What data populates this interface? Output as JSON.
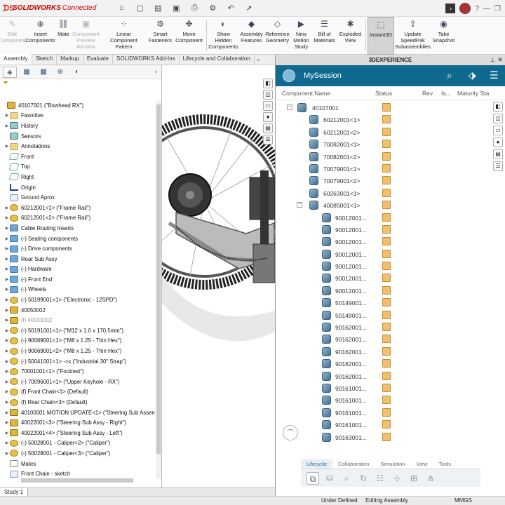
{
  "app": {
    "logo_brand": "SOLIDWORKS",
    "logo_suffix": "Connected",
    "accent": "#c00000"
  },
  "ribbon": {
    "buttons": [
      {
        "label": "Edit\nComponent",
        "icon": "edit-component-icon",
        "disabled": true
      },
      {
        "label": "Insert\nComponents",
        "icon": "insert-components-icon",
        "disabled": false
      },
      {
        "label": "Mate",
        "icon": "mate-icon",
        "disabled": false
      },
      {
        "label": "Component\nPreview\nWindow",
        "icon": "component-preview-icon",
        "disabled": true
      },
      {
        "label": "Linear Component\nPattern",
        "icon": "linear-pattern-icon",
        "disabled": false
      },
      {
        "label": "Smart\nFasteners",
        "icon": "smart-fasteners-icon",
        "disabled": false
      },
      {
        "label": "Move\nComponent",
        "icon": "move-component-icon",
        "disabled": false
      },
      {
        "label": "Show\nHidden\nComponents",
        "icon": "show-hidden-icon",
        "disabled": false
      },
      {
        "label": "Assembly\nFeatures",
        "icon": "assembly-features-icon",
        "disabled": false
      },
      {
        "label": "Reference\nGeometry",
        "icon": "reference-geometry-icon",
        "disabled": false
      },
      {
        "label": "New\nMotion\nStudy",
        "icon": "motion-study-icon",
        "disabled": false
      },
      {
        "label": "Bill of\nMaterials",
        "icon": "bom-icon",
        "disabled": false
      },
      {
        "label": "Exploded\nView",
        "icon": "exploded-view-icon",
        "disabled": false
      },
      {
        "label": "Instant3D",
        "icon": "instant3d-icon",
        "disabled": false,
        "active": true
      },
      {
        "label": "Update\nSpeedPak\nSubassemblies",
        "icon": "speedpak-icon",
        "disabled": false
      },
      {
        "label": "Take\nSnapshot",
        "icon": "snapshot-icon",
        "disabled": false
      }
    ]
  },
  "command_tabs": [
    "Assembly",
    "Sketch",
    "Markup",
    "Evaluate",
    "SOLIDWORKS Add-Ins",
    "Lifecycle and Collaboration"
  ],
  "feature_tree": [
    {
      "label": "40107001 (\"Bowhead RX\")",
      "icon": "asm",
      "level": 0,
      "exp": ""
    },
    {
      "label": "Favorites",
      "icon": "note",
      "level": 1,
      "exp": "▶"
    },
    {
      "label": "History",
      "icon": "sensor",
      "level": 1,
      "exp": "▶"
    },
    {
      "label": "Sensors",
      "icon": "sensor",
      "level": 1,
      "exp": ""
    },
    {
      "label": "Annotations",
      "icon": "note",
      "level": 1,
      "exp": "▶"
    },
    {
      "label": "Front",
      "icon": "plane",
      "level": 1,
      "exp": ""
    },
    {
      "label": "Top",
      "icon": "plane",
      "level": 1,
      "exp": ""
    },
    {
      "label": "Right",
      "icon": "plane",
      "level": 1,
      "exp": ""
    },
    {
      "label": "Origin",
      "icon": "origin",
      "level": 1,
      "exp": ""
    },
    {
      "label": "Ground Aprox",
      "icon": "sketch",
      "level": 1,
      "exp": ""
    },
    {
      "label": "60212001<1> (\"Frame Rail\")",
      "icon": "part",
      "level": 1,
      "exp": "▶"
    },
    {
      "label": "60212001<2> (\"Frame Rail\")",
      "icon": "part",
      "level": 1,
      "exp": "▶"
    },
    {
      "label": "Cable Routing Inserts",
      "icon": "folder",
      "level": 1,
      "exp": "▶"
    },
    {
      "label": "(-) Seating components",
      "icon": "folder",
      "level": 1,
      "exp": "▶"
    },
    {
      "label": "(-) Drive components",
      "icon": "folder",
      "level": 1,
      "exp": "▶"
    },
    {
      "label": "Rear Sub Assy",
      "icon": "folder",
      "level": 1,
      "exp": "▶"
    },
    {
      "label": "(-) Hardware",
      "icon": "folder",
      "level": 1,
      "exp": "▶"
    },
    {
      "label": "(-) Front End",
      "icon": "folder",
      "level": 1,
      "exp": "▶"
    },
    {
      "label": "(-) Wheels",
      "icon": "folder",
      "level": 1,
      "exp": "▶"
    },
    {
      "label": "(-) 50199001<1> (\"Electronic - 12SPD\")",
      "icon": "part",
      "level": 1,
      "exp": "▶"
    },
    {
      "label": "40050002",
      "icon": "asm",
      "level": 1,
      "exp": "▶"
    },
    {
      "label": "(f) 40033002",
      "icon": "asm",
      "level": 1,
      "exp": "▶",
      "dim": true
    },
    {
      "label": "(-) 50191001<1> (\"M12 x 1.0 x 170.5mm\")",
      "icon": "part",
      "level": 1,
      "exp": "▶"
    },
    {
      "label": "(-) 90069001<1> (\"M8 x 1.25 - Thin Hex\")",
      "icon": "part",
      "level": 1,
      "exp": "▶"
    },
    {
      "label": "(-) 90069001<2> (\"M8 x 1.25 - Thin Hex\")",
      "icon": "part",
      "level": 1,
      "exp": "▶"
    },
    {
      "label": "(-) 50041001<1> ->x (\"Industrial 30\" Strap\")",
      "icon": "part",
      "level": 1,
      "exp": "▶"
    },
    {
      "label": "70001001<1> (\"Footrest\")",
      "icon": "part",
      "level": 1,
      "exp": "▶"
    },
    {
      "label": "(-) 70096001<1> (\"Upper Keyhole - RX\")",
      "icon": "part",
      "level": 1,
      "exp": "▶"
    },
    {
      "label": "(f) Front Chain<1> (Default)",
      "icon": "part",
      "level": 1,
      "exp": "▶"
    },
    {
      "label": "(f) Rear Chain<3> (Default)",
      "icon": "part",
      "level": 1,
      "exp": "▶"
    },
    {
      "label": "40100001 MOTION UPDATE<1> (\"Steering Sub Assen",
      "icon": "asm",
      "level": 1,
      "exp": "▶"
    },
    {
      "label": "40022001<3> (\"Steering Sub Assy - Right\")",
      "icon": "asm",
      "level": 1,
      "exp": "▶"
    },
    {
      "label": "40022001<4> (\"Steering Sub Assy - Left\")",
      "icon": "asm",
      "level": 1,
      "exp": "▶"
    },
    {
      "label": "(-) 50028001 - Caliper<2> (\"Caliper\")",
      "icon": "part",
      "level": 1,
      "exp": "▶"
    },
    {
      "label": "(-) 50028001 - Caliper<3> (\"Caliper\")",
      "icon": "part",
      "level": 1,
      "exp": "▶"
    },
    {
      "label": "Mates",
      "icon": "mates",
      "level": 1,
      "exp": ""
    },
    {
      "label": "Front Chain - sketch",
      "icon": "sketch",
      "level": 1,
      "exp": ""
    }
  ],
  "bottom_tab": "Study 1",
  "status": {
    "left": "Under Defined",
    "mid": "Editing Assembly",
    "units": "MMGS"
  },
  "x3d": {
    "panel_title": "3DEXPERIENCE",
    "session_name": "MySession",
    "columns": {
      "name": "Component Name",
      "status": "Status",
      "rev": "Rev",
      "is": "Is...",
      "maturity": "Maturity Sta"
    },
    "rows": [
      {
        "label": "40107001",
        "level": 0,
        "exp": "−"
      },
      {
        "label": "60212001<1>",
        "level": 1,
        "exp": ""
      },
      {
        "label": "60212001<2>",
        "level": 1,
        "exp": ""
      },
      {
        "label": "70082001<1>",
        "level": 1,
        "exp": ""
      },
      {
        "label": "70082001<2>",
        "level": 1,
        "exp": ""
      },
      {
        "label": "70079001<1>",
        "level": 1,
        "exp": ""
      },
      {
        "label": "70079001<2>",
        "level": 1,
        "exp": ""
      },
      {
        "label": "60263001<1>",
        "level": 1,
        "exp": ""
      },
      {
        "label": "40085001<1>",
        "level": 1,
        "exp": "−"
      },
      {
        "label": "90012001...",
        "level": 2,
        "exp": ""
      },
      {
        "label": "90012001...",
        "level": 2,
        "exp": ""
      },
      {
        "label": "90012001...",
        "level": 2,
        "exp": ""
      },
      {
        "label": "90012001...",
        "level": 2,
        "exp": ""
      },
      {
        "label": "90012001...",
        "level": 2,
        "exp": ""
      },
      {
        "label": "90012001...",
        "level": 2,
        "exp": ""
      },
      {
        "label": "90012001...",
        "level": 2,
        "exp": ""
      },
      {
        "label": "50149001...",
        "level": 2,
        "exp": ""
      },
      {
        "label": "50149001...",
        "level": 2,
        "exp": ""
      },
      {
        "label": "90162001...",
        "level": 2,
        "exp": ""
      },
      {
        "label": "90162001...",
        "level": 2,
        "exp": ""
      },
      {
        "label": "90162001...",
        "level": 2,
        "exp": ""
      },
      {
        "label": "90162001...",
        "level": 2,
        "exp": ""
      },
      {
        "label": "90162001...",
        "level": 2,
        "exp": ""
      },
      {
        "label": "90161001...",
        "level": 2,
        "exp": ""
      },
      {
        "label": "90161001...",
        "level": 2,
        "exp": ""
      },
      {
        "label": "90161001...",
        "level": 2,
        "exp": ""
      },
      {
        "label": "90161001...",
        "level": 2,
        "exp": ""
      },
      {
        "label": "90163001...",
        "level": 2,
        "exp": ""
      }
    ],
    "lifecycle_tabs": [
      "Lifecycle",
      "Collaboration",
      "Simulation",
      "View",
      "Tools"
    ],
    "session_color": "#10698f"
  }
}
